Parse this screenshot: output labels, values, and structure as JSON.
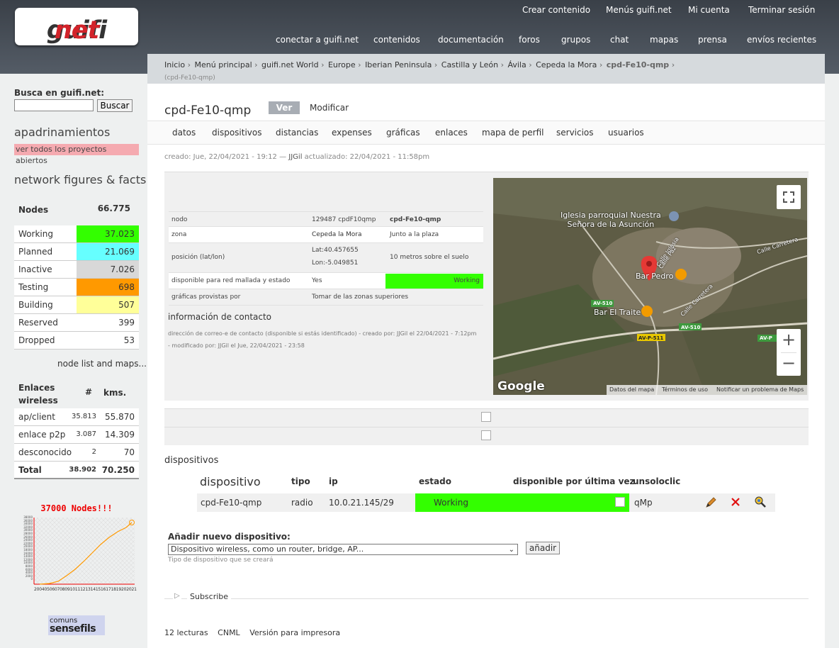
{
  "header": {
    "logo": {
      "part1": "guifi",
      "dot": "·",
      "part2": "net"
    },
    "user_nav": [
      "Crear contenido",
      "Menús guifi.net",
      "Mi cuenta",
      "Terminar sesión"
    ],
    "main_nav": [
      "conectar a guifi.net",
      "contenidos",
      "documentación",
      "foros",
      "grupos",
      "chat",
      "mapas",
      "prensa",
      "envíos recientes"
    ]
  },
  "sidebar": {
    "search_label": "Busca en guifi.net:",
    "search_value": "",
    "search_button": "Buscar",
    "apad_title": "apadrinamientos",
    "apad_link": "ver todos los proyectos abiertos",
    "figures_title": "network figures & facts",
    "nodes_label": "Nodes",
    "nodes_value": "66.775",
    "status_rows": [
      {
        "name": "Working",
        "value": "37.023",
        "color": "#33ff00"
      },
      {
        "name": "Planned",
        "value": "21.069",
        "color": "#66ffff"
      },
      {
        "name": "Inactive",
        "value": "7.026",
        "color": "#d8d8d8"
      },
      {
        "name": "Testing",
        "value": "698",
        "color": "#ff9900"
      },
      {
        "name": "Building",
        "value": "507",
        "color": "#ffff99"
      },
      {
        "name": "Reserved",
        "value": "399",
        "color": "#ffffff"
      },
      {
        "name": "Dropped",
        "value": "53",
        "color": "#ffffff"
      }
    ],
    "node_list_link": "node list and maps...",
    "links_header": {
      "name1": "Enlaces",
      "name2": "wireless",
      "count": "#",
      "kms": "kms."
    },
    "links_rows": [
      {
        "name": "ap/client",
        "count": "35.813",
        "kms": "55.870"
      },
      {
        "name": "enlace p2p",
        "count": "3.087",
        "kms": "14.309"
      },
      {
        "name": "desconocido",
        "count": "2",
        "kms": "70"
      }
    ],
    "links_total": {
      "name": "Total",
      "count": "38.902",
      "kms": "70.250"
    },
    "growth_chart": {
      "title": "37000 Nodes!!!",
      "x_ticks": "2004050607080910111213141516171819202021",
      "y_ticks": [
        "38000",
        "36000",
        "34000",
        "32000",
        "30000",
        "28000",
        "26000",
        "24000",
        "22000",
        "20000",
        "18000",
        "16000",
        "14000",
        "12000",
        "10000",
        "8000",
        "6000",
        "4000",
        "2000",
        "0"
      ]
    },
    "sponsor": {
      "line1": "comuns",
      "line2": "sensefils"
    }
  },
  "breadcrumb": {
    "items": [
      "Inicio",
      "Menú principal",
      "guifi.net World",
      "Europe",
      "Iberian Peninsula",
      "Castilla y León",
      "Ávila",
      "Cepeda la Mora"
    ],
    "current": "cpd-Fe10-qmp",
    "sub": "(cpd-Fe10-qmp)",
    "separator": "›"
  },
  "node": {
    "title": "cpd-Fe10-qmp",
    "tab_view": "Ver",
    "tab_edit": "Modificar",
    "subtabs": [
      "datos",
      "dispositivos",
      "distancias",
      "expenses",
      "gráficas",
      "enlaces",
      "mapa de perfil",
      "servicios",
      "usuarios"
    ],
    "created_prefix": "creado: Jue, 22/04/2021 - 19:12 — ",
    "created_user": "JJGil",
    "created_suffix": " actualizado: 22/04/2021 - 11:58pm",
    "info": {
      "nodo_label": "nodo",
      "nodo_id": "129487 cpdF10qmp",
      "nodo_name": "cpd-Fe10-qmp",
      "zona_label": "zona",
      "zona_value": "Cepeda la Mora",
      "zona_note": "Junto a la plaza",
      "pos_label": "posición (lat/lon)",
      "lat": "Lat:40.457655",
      "lon": "Lon:-5.049851",
      "height": "10 metros sobre el suelo",
      "mesh_label": "disponible para red mallada y estado",
      "mesh_value": "Yes",
      "mesh_state": "Working",
      "graph_label": "gráficas provistas por",
      "graph_value": "Tomar de las zonas superiores"
    },
    "contact_title": "información de contacto",
    "contact_text": "dirección de correo-e de contacto (disponible si estás identificado) - creado por: JJGil el 22/04/2021 - 7:12pm - modificado por: JJGil el Jue, 22/04/2021 - 23:58"
  },
  "map": {
    "labels": [
      "Iglesia parroquial Nuestra",
      "Señora de la Asunción",
      "Calle Carretera",
      "Calle Iglesia",
      "Calle Paz",
      "Bar Pedro",
      "Bar El Traite",
      "Calle Carretera",
      "AV-510",
      "AV-510",
      "AV-P-511",
      "AV-P"
    ],
    "brand": "Google",
    "footer": [
      "Datos del mapa",
      "Términos de uso",
      "Notificar un problema de Maps"
    ],
    "zoom_in": "+",
    "zoom_out": "−"
  },
  "devices": {
    "title": "dispositivos",
    "headers": [
      "dispositivo",
      "tipo",
      "ip",
      "estado",
      "disponible por última vez",
      "unsoloclic"
    ],
    "row": {
      "name": "cpd-Fe10-qmp",
      "type": "radio",
      "ip": "10.0.21.145/29",
      "state": "Working",
      "unsoloclic": "qMp"
    },
    "add_label": "Añadir nuevo dispositivo:",
    "add_select": "Dispositivo wireless, como un router, bridge, AP...",
    "add_button": "añadir",
    "add_help": "Tipo de dispositivo que se creará"
  },
  "footer": {
    "subscribe": "Subscribe",
    "links": [
      "12 lecturas",
      "CNML",
      "Versión para impresora"
    ]
  }
}
